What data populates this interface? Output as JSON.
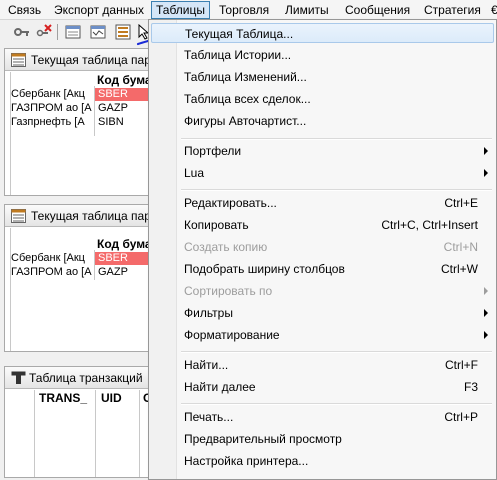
{
  "menubar": {
    "items": [
      {
        "label": "Связь"
      },
      {
        "label": "Экспорт данных"
      },
      {
        "label": "Таблицы"
      },
      {
        "label": "Торговля"
      },
      {
        "label": "Лимиты"
      },
      {
        "label": "Сообщения"
      },
      {
        "label": "Стратегия"
      },
      {
        "label": "€"
      }
    ],
    "active": "Таблицы"
  },
  "toolbar": {
    "icons": [
      "key-icon",
      "disconnect-icon",
      "table-icon",
      "window-icon",
      "list-icon",
      "cursor-icon"
    ]
  },
  "panels": [
    {
      "title": "Текущая таблица пар",
      "col_code": "Код бума",
      "rows": [
        {
          "name": "Сбербанк [Акц",
          "code": "SBER",
          "highlight": true
        },
        {
          "name": "ГАЗПРОМ ао [А",
          "code": "GAZP",
          "highlight": false
        },
        {
          "name": "Газпрнефть [А",
          "code": "SIBN",
          "highlight": false
        }
      ]
    },
    {
      "title": "Текущая таблица пар",
      "col_code": "Код бума",
      "rows": [
        {
          "name": "Сбербанк [Акц",
          "code": "SBER",
          "highlight": true
        },
        {
          "name": "ГАЗПРОМ ао [А",
          "code": "GAZP",
          "highlight": false
        }
      ]
    },
    {
      "title": "Таблица транзакций",
      "columns": [
        "TRANS_",
        "UID",
        "C"
      ]
    }
  ],
  "dropdown": {
    "items": [
      {
        "label": "Текущая Таблица...",
        "shortcut": "",
        "submenu": false,
        "disabled": false,
        "highlight": true
      },
      {
        "label": "Таблица Истории...",
        "shortcut": "",
        "submenu": false,
        "disabled": false
      },
      {
        "label": "Таблица Изменений...",
        "shortcut": "",
        "submenu": false,
        "disabled": false
      },
      {
        "label": "Таблица всех сделок...",
        "shortcut": "",
        "submenu": false,
        "disabled": false
      },
      {
        "label": "Фигуры Автočартист...",
        "shortcut": "",
        "submenu": false,
        "disabled": false
      },
      {
        "label": "Портфели",
        "shortcut": "",
        "submenu": true,
        "disabled": false
      },
      {
        "label": "Lua",
        "shortcut": "",
        "submenu": true,
        "disabled": false
      },
      {
        "label": "Редактировать...",
        "shortcut": "Ctrl+E",
        "submenu": false,
        "disabled": false
      },
      {
        "label": "Копировать",
        "shortcut": "Ctrl+C, Ctrl+Insert",
        "submenu": false,
        "disabled": false
      },
      {
        "label": "Создать копию",
        "shortcut": "Ctrl+N",
        "submenu": false,
        "disabled": true
      },
      {
        "label": "Подобрать ширину столбцов",
        "shortcut": "Ctrl+W",
        "submenu": false,
        "disabled": false
      },
      {
        "label": "Сортировать по",
        "shortcut": "",
        "submenu": true,
        "disabled": true
      },
      {
        "label": "Фильтры",
        "shortcut": "",
        "submenu": true,
        "disabled": false
      },
      {
        "label": "Форматирование",
        "shortcut": "",
        "submenu": true,
        "disabled": false
      },
      {
        "label": "Найти...",
        "shortcut": "Ctrl+F",
        "submenu": false,
        "disabled": false
      },
      {
        "label": "Найти далее",
        "shortcut": "F3",
        "submenu": false,
        "disabled": false
      },
      {
        "label": "Печать...",
        "shortcut": "Ctrl+P",
        "submenu": false,
        "disabled": false
      },
      {
        "label": "Предварительный просмотр",
        "shortcut": "",
        "submenu": false,
        "disabled": false
      },
      {
        "label": "Настройка принтера...",
        "shortcut": "",
        "submenu": false,
        "disabled": false
      }
    ]
  },
  "colors": {
    "highlight_cell": "#f46a6a",
    "menu_active": "#d5e6f8",
    "pen_mark": "#1a2ad6"
  }
}
